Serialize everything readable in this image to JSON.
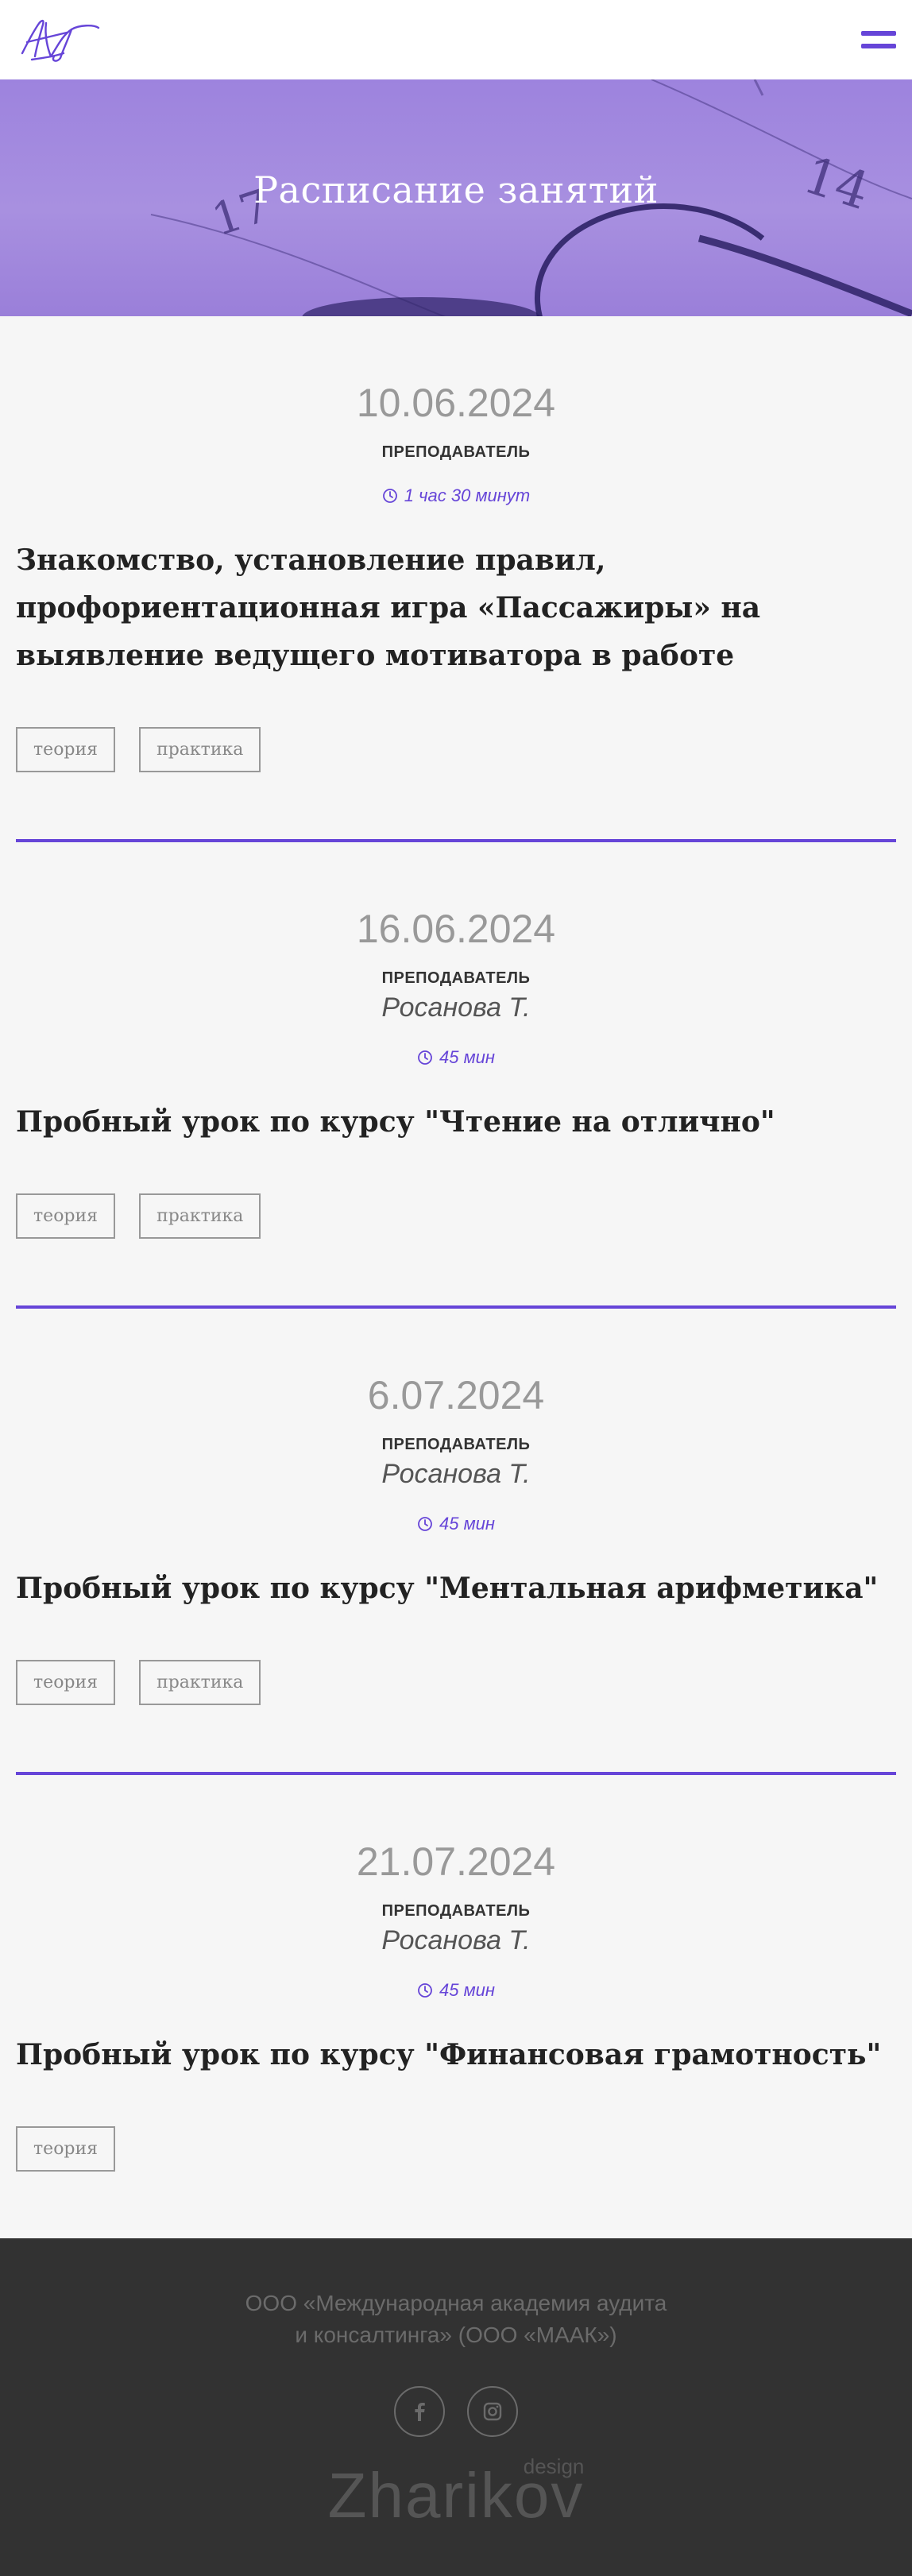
{
  "header": {
    "logo_label": "logo",
    "menu_icon": "burger-menu-icon"
  },
  "hero": {
    "title": "Расписание занятий"
  },
  "lessons": [
    {
      "date": "10.06.2024",
      "role": "ПРЕПОДАВАТЕЛЬ",
      "teacher": "",
      "duration": "1 час 30 минут",
      "title": "Знакомство, установление правил, профориентационная игра «Пассажиры» на выявление ведущего мотиватора в работе",
      "tags": [
        "теория",
        "практика"
      ]
    },
    {
      "date": "16.06.2024",
      "role": "ПРЕПОДАВАТЕЛЬ",
      "teacher": "Росанова Т.",
      "duration": "45 мин",
      "title": "Пробный урок по курсу \"Чтение на отлично\"",
      "tags": [
        "теория",
        "практика"
      ]
    },
    {
      "date": "6.07.2024",
      "role": "ПРЕПОДАВАТЕЛЬ",
      "teacher": "Росанова Т.",
      "duration": "45 мин",
      "title": "Пробный урок по курсу \"Ментальная арифметика\"",
      "tags": [
        "теория",
        "практика"
      ]
    },
    {
      "date": "21.07.2024",
      "role": "ПРЕПОДАВАТЕЛЬ",
      "teacher": "Росанова Т.",
      "duration": "45 мин",
      "title": "Пробный урок по курсу \"Финансовая грамотность\"",
      "tags": [
        "теория"
      ]
    }
  ],
  "footer": {
    "company_line1": "ООО «Международная академия аудита",
    "company_line2": "и консалтинга» (ООО «МААК»)",
    "socials": [
      "facebook-icon",
      "instagram-icon"
    ],
    "credit_name": "Zharikov",
    "credit_sub": "design"
  },
  "colors": {
    "accent": "#6645d8",
    "hero": "#a08ae0",
    "footer_bg": "#323232",
    "page_bg": "#f6f6f6"
  }
}
